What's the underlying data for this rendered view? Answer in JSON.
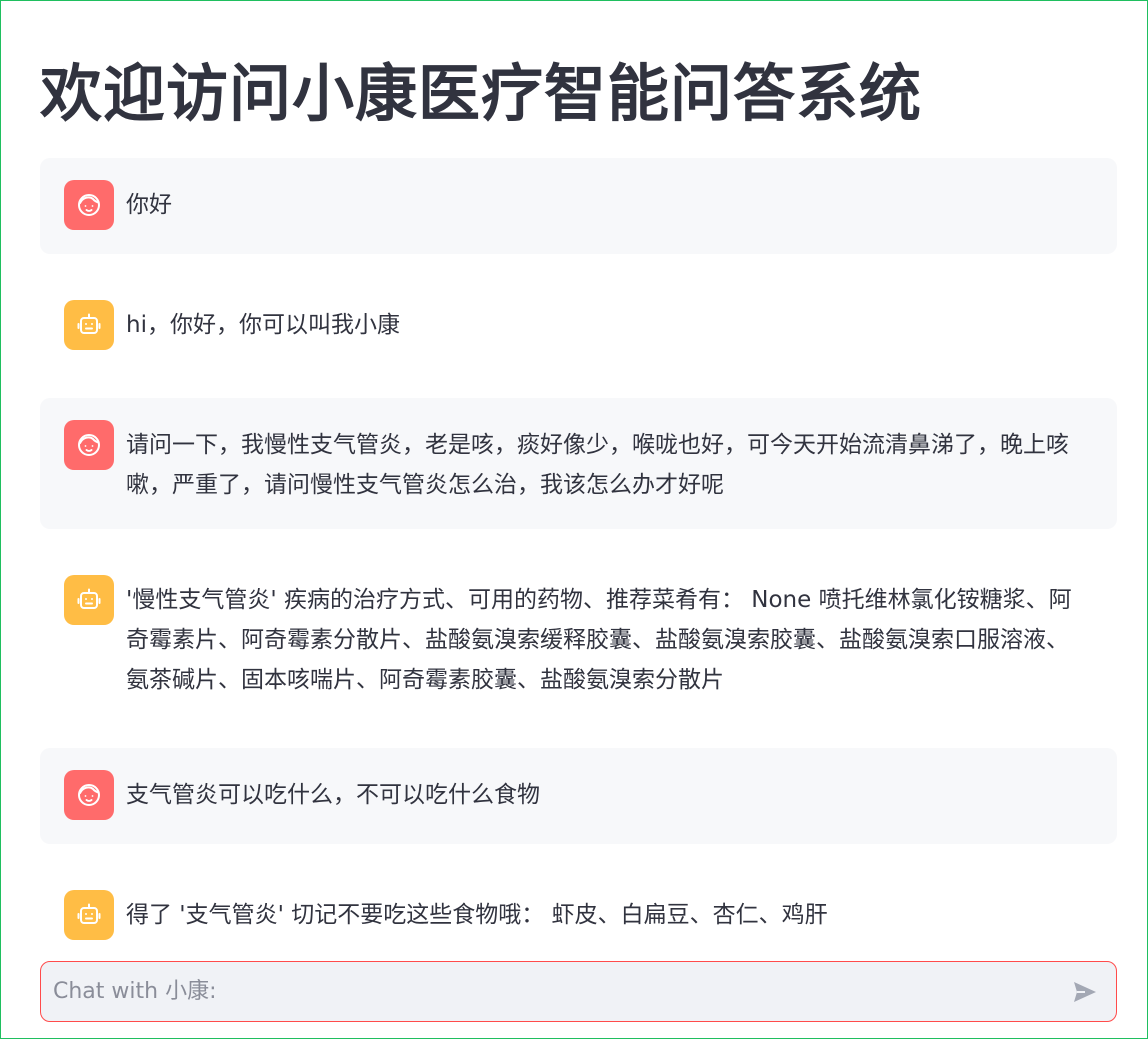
{
  "page": {
    "title": "欢迎访问小康医疗智能问答系统"
  },
  "messages": [
    {
      "role": "user",
      "avatar_icon": "user-face-icon",
      "text": "你好"
    },
    {
      "role": "assistant",
      "avatar_icon": "robot-icon",
      "text": "hi，你好，你可以叫我小康"
    },
    {
      "role": "user",
      "avatar_icon": "user-face-icon",
      "text": "请问一下，我慢性支气管炎，老是咳，痰好像少，喉咙也好，可今天开始流清鼻涕了，晚上咳嗽，严重了，请问慢性支气管炎怎么治，我该怎么办才好呢"
    },
    {
      "role": "assistant",
      "avatar_icon": "robot-icon",
      "text": "'慢性支气管炎' 疾病的治疗方式、可用的药物、推荐菜肴有： None 喷托维林氯化铵糖浆、阿奇霉素片、阿奇霉素分散片、盐酸氨溴索缓释胶囊、盐酸氨溴索胶囊、盐酸氨溴索口服溶液、氨茶碱片、固本咳喘片、阿奇霉素胶囊、盐酸氨溴索分散片"
    },
    {
      "role": "user",
      "avatar_icon": "user-face-icon",
      "text": "支气管炎可以吃什么，不可以吃什么食物"
    },
    {
      "role": "assistant",
      "avatar_icon": "robot-icon",
      "text": "得了 '支气管炎' 切记不要吃这些食物哦： 虾皮、白扁豆、杏仁、鸡肝"
    }
  ],
  "chat_input": {
    "placeholder": "Chat with 小康:",
    "value": ""
  },
  "send_button": {
    "icon": "send-icon"
  },
  "colors": {
    "user_avatar": "#ff6b6b",
    "assistant_avatar": "#ffbd45",
    "user_bubble": "#f7f8fa",
    "input_border": "#ff4b4b",
    "input_background": "#f0f2f6",
    "text": "#31333f",
    "frame_border": "#1fbf5f"
  }
}
